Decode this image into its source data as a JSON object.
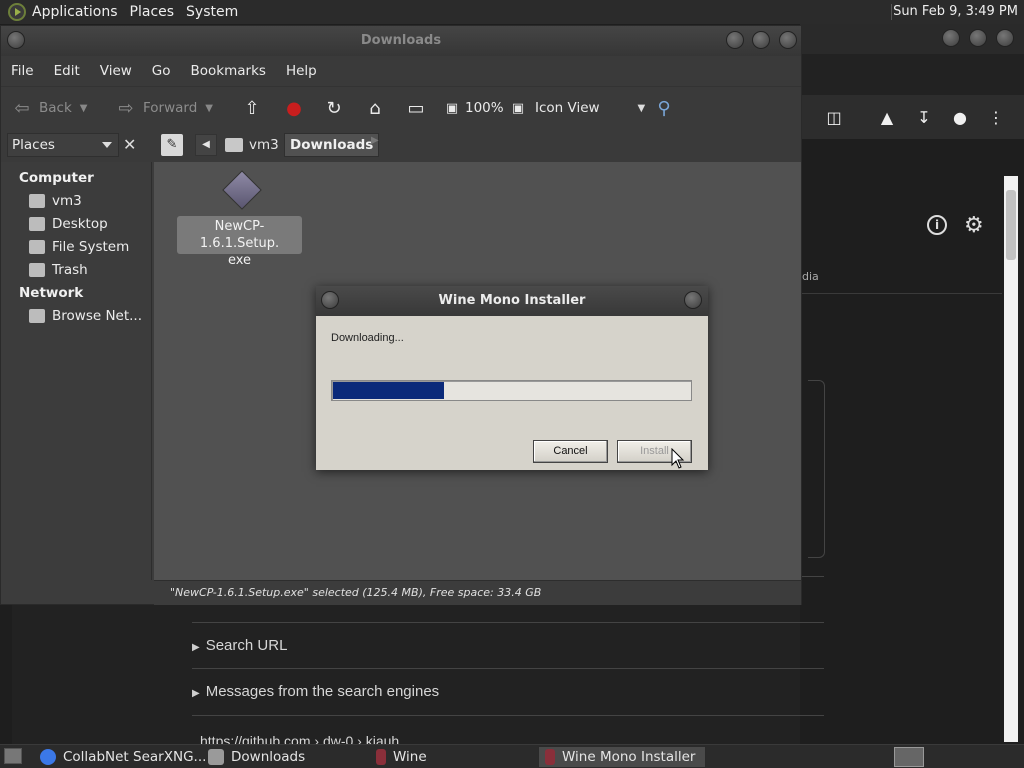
{
  "top_panel": {
    "menus": [
      "Applications",
      "Places",
      "System"
    ],
    "clock": "Sun Feb  9,  3:49 PM"
  },
  "file_manager": {
    "title": "Downloads",
    "menu": [
      "File",
      "Edit",
      "View",
      "Go",
      "Bookmarks",
      "Help"
    ],
    "toolbar": {
      "back": "Back",
      "forward": "Forward",
      "zoom": "100%",
      "view_mode": "Icon View"
    },
    "location": {
      "places_label": "Places",
      "crumbs": [
        "vm3",
        "Downloads"
      ]
    },
    "sidebar": {
      "computer_heading": "Computer",
      "computer_items": [
        "vm3",
        "Desktop",
        "File System",
        "Trash"
      ],
      "network_heading": "Network",
      "network_items": [
        "Browse Net..."
      ]
    },
    "file": {
      "name_line1": "NewCP-1.6.1.Setup.",
      "name_line2": "exe"
    },
    "status": "\"NewCP-1.6.1.Setup.exe\" selected (125.4 MB), Free space: 33.4 GB"
  },
  "dialog": {
    "title": "Wine Mono Installer",
    "message": "Downloading...",
    "progress": 0.31,
    "cancel_label": "Cancel",
    "install_label": "Install"
  },
  "browser_bg": {
    "tab_fragment": "dia",
    "rows": [
      "Search URL",
      "Messages from the search engines"
    ],
    "url_fragment": "https://github.com › dw-0 › kiauh"
  },
  "taskbar": {
    "tasks": [
      "CollabNet SearXNG...",
      "Downloads",
      "Wine",
      "Wine Mono Installer"
    ]
  },
  "colors": {
    "progress_fill": "#0b2a7a",
    "dialog_bg": "#d6d3cb"
  }
}
